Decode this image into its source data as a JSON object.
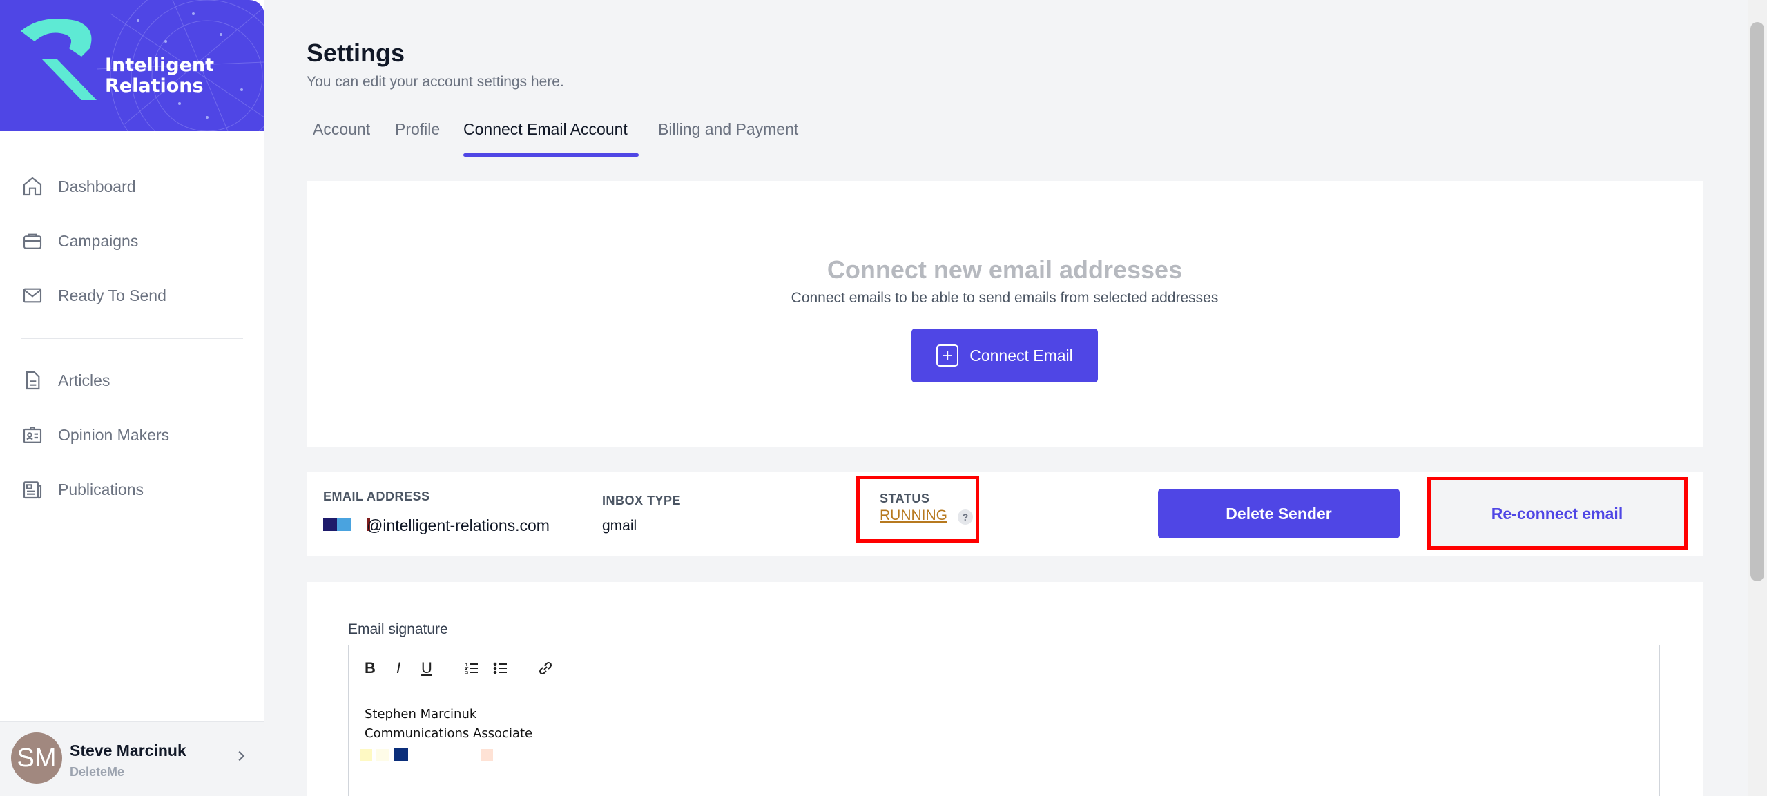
{
  "brand": {
    "line1": "Intelligent",
    "line2": "Relations",
    "accent": "#4f46e5",
    "logo_mark_color": "#5eead4"
  },
  "sidebar": {
    "items": [
      {
        "label": "Dashboard",
        "icon": "home-icon"
      },
      {
        "label": "Campaigns",
        "icon": "briefcase-icon"
      },
      {
        "label": "Ready To Send",
        "icon": "mail-icon"
      },
      {
        "label": "Articles",
        "icon": "document-icon"
      },
      {
        "label": "Opinion Makers",
        "icon": "contact-card-icon"
      },
      {
        "label": "Publications",
        "icon": "newspaper-icon"
      }
    ]
  },
  "user": {
    "initials": "SM",
    "name": "Steve Marcinuk",
    "org": "DeleteMe"
  },
  "header": {
    "title": "Settings",
    "subtitle": "You can edit your account settings here."
  },
  "tabs": [
    {
      "label": "Account",
      "active": false
    },
    {
      "label": "Profile",
      "active": false
    },
    {
      "label": "Connect Email Account",
      "active": true
    },
    {
      "label": "Billing and Payment",
      "active": false
    }
  ],
  "connect": {
    "title": "Connect new email addresses",
    "subtitle": "Connect emails to be able to send emails from selected addresses",
    "button_label": "Connect Email"
  },
  "sender": {
    "email_label": "EMAIL ADDRESS",
    "email_value": "@intelligent-relations.com",
    "inbox_label": "INBOX TYPE",
    "inbox_value": "gmail",
    "status_label": "STATUS",
    "status_value": "RUNNING",
    "help_glyph": "?",
    "delete_label": "Delete Sender",
    "reconnect_label": "Re-connect email",
    "status_color": "#b7791f",
    "highlight_color": "#ff0000"
  },
  "signature": {
    "label": "Email signature",
    "toolbar": {
      "bold": "B",
      "italic": "I",
      "underline": "U"
    },
    "line1": "Stephen Marcinuk",
    "line2": "Communications Associate"
  }
}
